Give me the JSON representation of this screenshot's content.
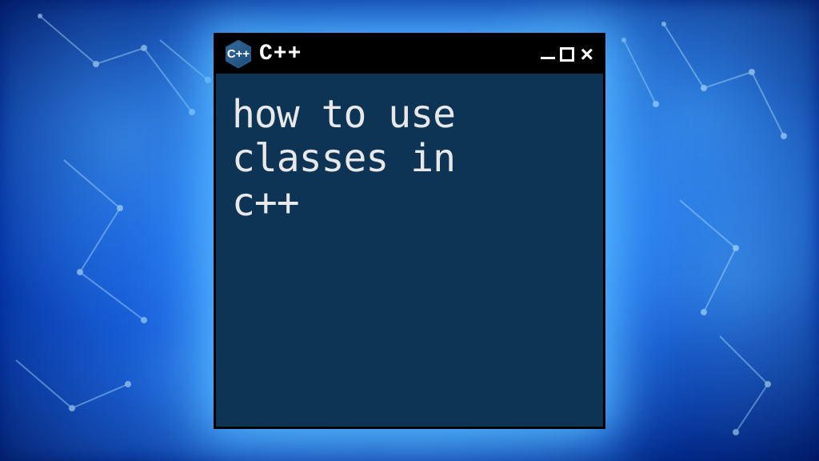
{
  "window": {
    "icon_label": "C++",
    "title": "C++",
    "content": "how to use\nclasses in\nc++"
  }
}
